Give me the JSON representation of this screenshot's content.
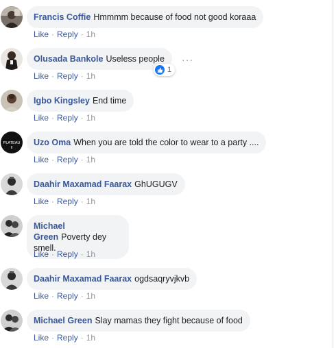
{
  "actions": {
    "like": "Like",
    "reply": "Reply",
    "separator": "·"
  },
  "comments": [
    {
      "author": "Francis Coffie",
      "text": "Hmmmm because of food not good koraaa",
      "time": "1h",
      "avatar_icon": "person-photo-icon"
    },
    {
      "author": "Olusada Bankole",
      "text": "Useless people",
      "time": "1h",
      "avatar_icon": "person-photo-icon",
      "reaction_count": "1",
      "reaction_icon": "like-reaction-icon",
      "more_icon": "more-options-icon",
      "more_glyph": "···"
    },
    {
      "author": "Igbo Kingsley",
      "text": "End time",
      "time": "1h",
      "avatar_icon": "person-photo-icon"
    },
    {
      "author": "Uzo Oma",
      "text": "When you are told the color to wear to a party ....",
      "time": "1h",
      "avatar_icon": "plateau-logo-icon",
      "avatar_text": "PLATEAU"
    },
    {
      "author": "Daahir Maxamad Faarax",
      "text": "GhUGUGV",
      "time": "1h",
      "avatar_icon": "person-photo-icon"
    },
    {
      "author": "Michael Green",
      "text": "Poverty dey smell.",
      "time": "1h",
      "avatar_icon": "person-photo-icon"
    },
    {
      "author": "Daahir Maxamad Faarax",
      "text": "ogdsaqryvjkvb",
      "time": "1h",
      "avatar_icon": "person-photo-icon"
    },
    {
      "author": "Michael Green",
      "text": "Slay mamas they fight because of food",
      "time": "1h",
      "avatar_icon": "person-photo-icon"
    }
  ],
  "colors": {
    "author_link": "#385898",
    "bubble_bg": "#f2f3f5",
    "meta_gray": "#90949c",
    "like_blue": "#1877f2"
  }
}
